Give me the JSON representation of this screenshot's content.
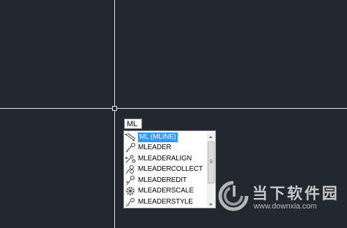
{
  "command_line": {
    "input_value": "ML"
  },
  "autocomplete": {
    "items": [
      {
        "label": "ML (MLINE)",
        "icon": "mline-icon",
        "selected": true
      },
      {
        "label": "MLEADER",
        "icon": "mleader-icon",
        "selected": false
      },
      {
        "label": "MLEADERALIGN",
        "icon": "mleaderalign-icon",
        "selected": false
      },
      {
        "label": "MLEADERCOLLECT",
        "icon": "mleadercollect-icon",
        "selected": false
      },
      {
        "label": "MLEADEREDIT",
        "icon": "mleaderedit-icon",
        "selected": false
      },
      {
        "label": "MLEADERSCALE",
        "icon": "mleaderscale-icon",
        "selected": false
      },
      {
        "label": "MLEADERSTYLE",
        "icon": "mleaderstyle-icon",
        "selected": false
      }
    ]
  },
  "watermark": {
    "name": "当下软件园",
    "url": "www.downxia.com"
  },
  "colors": {
    "canvas_bg": "#212830",
    "crosshair": "#e6e6e6",
    "selection": "#3399ff"
  }
}
